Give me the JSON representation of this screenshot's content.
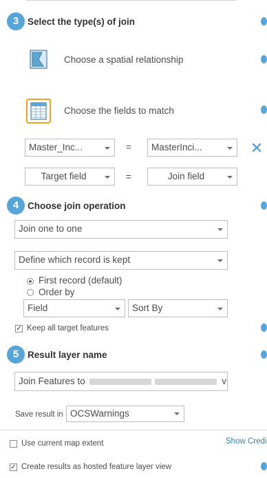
{
  "steps": {
    "s3": {
      "number": "3",
      "title": "Select the type(s) of join"
    },
    "s4": {
      "number": "4",
      "title": "Choose join operation"
    },
    "s5": {
      "number": "5",
      "title": "Result layer name"
    }
  },
  "join_types": {
    "spatial_label": "Choose a spatial relationship",
    "fields_label": "Choose the fields to match"
  },
  "field_match": {
    "row1": {
      "target": "Master_Inc...",
      "operator": "=",
      "join": "MasterInci..."
    },
    "row2": {
      "target": "Target field",
      "operator": "=",
      "join": "Join field"
    }
  },
  "join_operation": {
    "selected": "Join one to one",
    "record_rule": "Define which record is kept",
    "options": [
      "First record (default)",
      "Order by"
    ],
    "selected_option": "First record (default)",
    "order_field": "Field",
    "sort": "Sort By",
    "keep_all_label": "Keep all target features",
    "keep_all_checked": true
  },
  "result": {
    "name_prefix": "Join Features to",
    "name_suffix": "v",
    "save_label": "Save result in",
    "folder": "OCSWarnings"
  },
  "footer": {
    "extent_label": "Use current map extent",
    "extent_checked": false,
    "show_credits": "Show Credi",
    "hosted_view_label": "Create results as hosted feature layer view",
    "hosted_view_checked": true
  },
  "colors": {
    "accent": "#56a5d8",
    "remove": "#5aa3d3",
    "highlight": "#f0a028"
  },
  "icons": [
    "spatial-relationship-icon",
    "fields-table-icon",
    "remove-icon",
    "info-icon",
    "chevron-down-icon"
  ]
}
